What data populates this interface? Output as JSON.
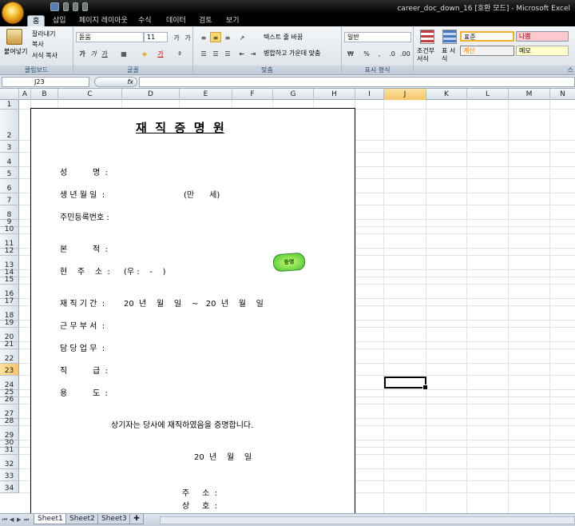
{
  "window": {
    "title": "career_doc_down_16 [호환 모드] - Microsoft Excel"
  },
  "tabs": [
    {
      "label": "홈",
      "active": true
    },
    {
      "label": "삽입"
    },
    {
      "label": "페이지 레이아웃"
    },
    {
      "label": "수식"
    },
    {
      "label": "데이터"
    },
    {
      "label": "검토"
    },
    {
      "label": "보기"
    }
  ],
  "ribbon": {
    "clipboard": {
      "paste": "붙여넣기",
      "cut": "잘라내기",
      "copy": "복사",
      "format_painter": "서식 복사",
      "group": "클립보드"
    },
    "font": {
      "name": "돋움",
      "size": "11",
      "bold": "가",
      "italic": "가",
      "underline": "가",
      "group": "글꼴"
    },
    "alignment": {
      "wrap": "텍스트 줄 바꿈",
      "merge": "병합하고 가운데 맞춤",
      "group": "맞춤"
    },
    "number": {
      "format": "일반",
      "group": "표시 형식"
    },
    "styles": {
      "conditional": "조건부 서식",
      "table": "표 서식",
      "normal": "표준",
      "bad": "나쁨",
      "calc": "계산",
      "memo": "메모",
      "group_initial": "스"
    }
  },
  "formula_bar": {
    "name_box": "J23",
    "fx": "fx",
    "content": ""
  },
  "columns": [
    "A",
    "B",
    "C",
    "D",
    "E",
    "F",
    "G",
    "H",
    "I",
    "J",
    "K",
    "L",
    "M",
    "N"
  ],
  "selected_column": "J",
  "rows": [
    "1",
    "2",
    "3",
    "4",
    "5",
    "6",
    "7",
    "8",
    "9",
    "10",
    "11",
    "12",
    "13",
    "14",
    "15",
    "16",
    "17",
    "18",
    "19",
    "20",
    "21",
    "22",
    "23",
    "24",
    "25",
    "26",
    "27",
    "28",
    "29",
    "30",
    "31",
    "32",
    "33",
    "34"
  ],
  "selected_row": "23",
  "document": {
    "title": "재  직  증  명  원",
    "name_label": "성          명  :",
    "birth_label": "생 년 월 일  :",
    "age_text": "(만      세)",
    "id_label": "주민등록번호 :",
    "origin_label": "본          적  :",
    "address_label": "현    주    소  :",
    "address_value": "(우 :    -    )",
    "period_label": "재 직 기 간  :",
    "period_value": "20  년    월    일    ~   20  년    월    일",
    "dept_label": "근 무 부 서  :",
    "duty_label": "담 당 업 무  :",
    "rank_label": "직          급  :",
    "purpose_label": "용          도  :",
    "statement": "상기자는 당사에 재직하였음을 증명합니다.",
    "date_line": "20  년    월    일",
    "company_addr_label": "주     소  :",
    "company_name_label": "상     호  :",
    "stamp_text": "증명"
  },
  "sheet_tabs": [
    {
      "label": "Sheet1",
      "active": true
    },
    {
      "label": "Sheet2"
    },
    {
      "label": "Sheet3"
    }
  ]
}
